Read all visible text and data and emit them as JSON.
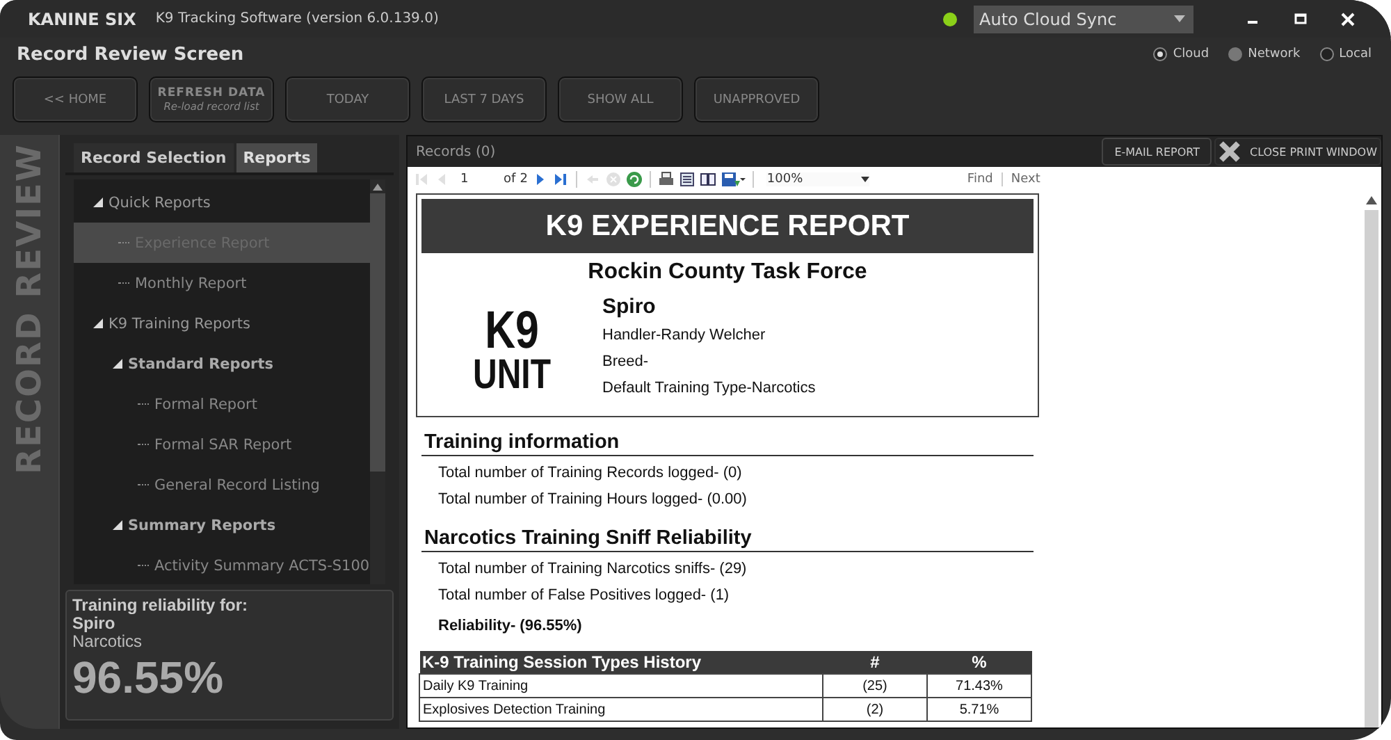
{
  "window": {
    "brand": "KANINE SIX",
    "title": "K9 Tracking Software (version 6.0.139.0)",
    "sync_online": true,
    "sync_mode": "Auto Cloud Sync",
    "controls": [
      {
        "kind": "minimize"
      },
      {
        "kind": "maximize"
      },
      {
        "kind": "close"
      }
    ]
  },
  "screen_title": "Record Review Screen",
  "storage": [
    {
      "label": "Cloud",
      "selected": true,
      "disabled": false
    },
    {
      "label": "Network",
      "selected": false,
      "disabled": true
    },
    {
      "label": "Local",
      "selected": false,
      "disabled": false
    }
  ],
  "nav_buttons": [
    {
      "label": "<< HOME"
    },
    {
      "label": "REFRESH DATA",
      "sub": "Re-load record list"
    },
    {
      "label": "TODAY"
    },
    {
      "label": "LAST 7 DAYS"
    },
    {
      "label": "SHOW ALL"
    },
    {
      "label": "UNAPPROVED"
    }
  ],
  "side_caption": "RECORD REVIEW",
  "tabs": [
    {
      "label": "Record Selection",
      "selected": false
    },
    {
      "label": "Reports",
      "selected": true
    }
  ],
  "tree": [
    {
      "label": "Quick Reports",
      "kind": "folder",
      "expanded": true,
      "selected": false,
      "children": [
        {
          "label": "Experience Report",
          "kind": "report",
          "selected": true
        },
        {
          "label": "Monthly Report",
          "kind": "report",
          "selected": false
        }
      ]
    },
    {
      "label": "K9 Training Reports",
      "kind": "folder",
      "expanded": true,
      "selected": false,
      "children": [
        {
          "label": "Standard Reports",
          "kind": "group",
          "expanded": true,
          "selected": false,
          "children": [
            {
              "label": "Formal Report",
              "kind": "report",
              "selected": false
            },
            {
              "label": "Formal SAR Report",
              "kind": "report",
              "selected": false
            },
            {
              "label": "General Record Listing",
              "kind": "report",
              "selected": false
            }
          ]
        },
        {
          "label": "Summary Reports",
          "kind": "group",
          "expanded": true,
          "selected": false,
          "children": [
            {
              "label": "Activity Summary ACTS-S100",
              "kind": "report",
              "selected": false
            }
          ]
        }
      ]
    }
  ],
  "reliability": {
    "heading": "Training reliability  for:",
    "dog": "Spiro",
    "type": "Narcotics",
    "value": "96.55%"
  },
  "records": {
    "title": "Records (0)",
    "buttons": [
      {
        "label": "E-MAIL REPORT",
        "kind": "plain"
      },
      {
        "label": "CLOSE PRINT WINDOW",
        "kind": "close"
      }
    ]
  },
  "viewer_toolbar": {
    "page": "1",
    "of": "of",
    "pages": "2",
    "zoom": "100%",
    "find": "Find",
    "next": "Next",
    "tools": [
      {
        "kind": "first",
        "disabled": true
      },
      {
        "kind": "prev",
        "disabled": true
      },
      {
        "kind": "pageinput"
      },
      {
        "kind": "next",
        "disabled": false
      },
      {
        "kind": "last",
        "disabled": false
      },
      {
        "kind": "sep"
      },
      {
        "kind": "back",
        "disabled": true
      },
      {
        "kind": "stop",
        "disabled": true
      },
      {
        "kind": "refresh",
        "disabled": false
      },
      {
        "kind": "sep"
      },
      {
        "kind": "print",
        "disabled": false
      },
      {
        "kind": "layout",
        "disabled": false
      },
      {
        "kind": "pagesetup",
        "disabled": false
      },
      {
        "kind": "export",
        "disabled": false
      },
      {
        "kind": "sep"
      },
      {
        "kind": "zoom"
      }
    ]
  },
  "report": {
    "title": "K9 EXPERIENCE REPORT",
    "agency": "Rockin County Task Force",
    "logo": [
      "K9",
      "UNIT"
    ],
    "dog": "Spiro",
    "details": [
      "Handler-Randy Welcher",
      "Breed-",
      "Default Training Type-Narcotics"
    ],
    "sections": [
      {
        "heading": "Training information",
        "lines": [
          {
            "text": "Total number of Training Records logged- (0)",
            "bold": false
          },
          {
            "text": "Total number of Training Hours logged- (0.00)",
            "bold": false
          }
        ]
      },
      {
        "heading": "Narcotics Training Sniff Reliability",
        "lines": [
          {
            "text": "Total number of Training Narcotics sniffs- (29)",
            "bold": false
          },
          {
            "text": "Total number of False Positives logged- (1)",
            "bold": false
          },
          {
            "text": "Reliability- (96.55%)",
            "bold": true
          }
        ]
      }
    ],
    "table": {
      "columns": [
        "K-9 Training Session Types History",
        "#",
        "%"
      ],
      "rows": [
        [
          "Daily K9 Training",
          "(25)",
          "71.43%"
        ],
        [
          "Explosives Detection Training",
          "(2)",
          "5.71%"
        ]
      ]
    }
  }
}
